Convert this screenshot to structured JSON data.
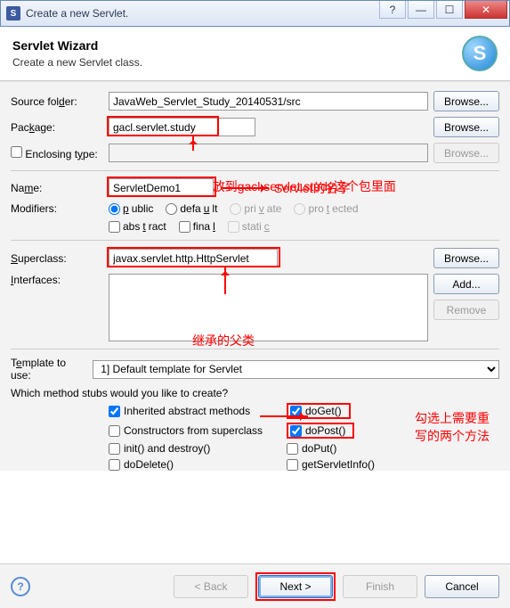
{
  "window": {
    "title": "Create a new Servlet."
  },
  "wizard": {
    "heading": "Servlet Wizard",
    "sub": "Create a new Servlet class."
  },
  "form": {
    "sourceFolder": {
      "label": "Source folder:",
      "value": "JavaWeb_Servlet_Study_20140531/src",
      "browse": "Browse..."
    },
    "package": {
      "label": "Package:",
      "value": "gacl.servlet.study",
      "browse": "Browse..."
    },
    "enclosing": {
      "label": "Enclosing type:",
      "value": "",
      "browse": "Browse..."
    },
    "name": {
      "label": "Name:",
      "value": "ServletDemo1"
    },
    "modifiersLabel": "Modifiers:",
    "modifiers": {
      "public": "public",
      "default": "default",
      "private": "private",
      "protected": "protected",
      "abstract": "abstract",
      "final": "final",
      "static": "static"
    },
    "superclass": {
      "label": "Superclass:",
      "value": "javax.servlet.http.HttpServlet",
      "browse": "Browse..."
    },
    "interfaces": {
      "label": "Interfaces:",
      "add": "Add...",
      "remove": "Remove"
    },
    "template": {
      "label": "Template to use:",
      "value": "1] Default template for Servlet"
    },
    "stubsQuestion": "Which method stubs would you like to create?",
    "stubs": {
      "inherited": "Inherited abstract methods",
      "constructors": "Constructors from superclass",
      "init": "init() and destroy()",
      "doDelete": "doDelete()",
      "doGet": "doGet()",
      "doPost": "doPost()",
      "doPut": "doPut()",
      "getServletInfo": "getServletInfo()"
    }
  },
  "annotations": {
    "a1": "将ServletDemo1放到gacl.servlet.study这个包里面",
    "a2": "Servlet的名字",
    "a3": "继承的父类",
    "a4": "勾选上需要重写的两个方法"
  },
  "footer": {
    "back": "< Back",
    "next": "Next >",
    "finish": "Finish",
    "cancel": "Cancel"
  }
}
